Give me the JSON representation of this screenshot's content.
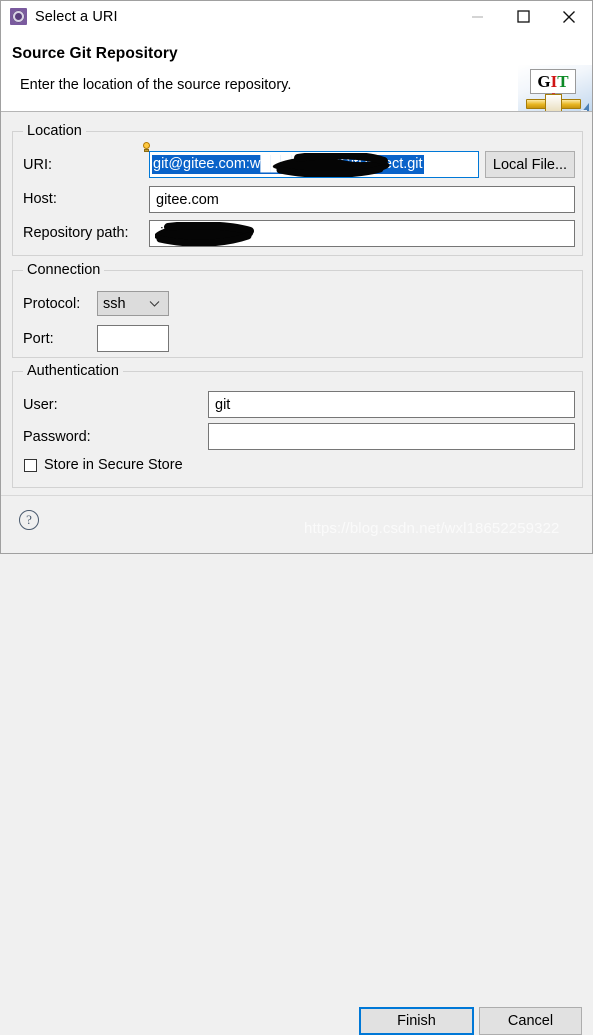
{
  "window": {
    "title": "Select a URI",
    "icon": "uri-dialog-icon",
    "controls": {
      "minimize": "minimize-icon",
      "maximize": "maximize-icon",
      "close": "close-icon"
    }
  },
  "header": {
    "title": "Source Git Repository",
    "subtitle": "Enter the location of the source repository.",
    "logo": {
      "g": "G",
      "i": "I",
      "t": "T"
    }
  },
  "location": {
    "group_label": "Location",
    "uri_label": "URI:",
    "uri_value": "git@gitee.com:w███████i/GitProject.git",
    "uri_selected": true,
    "local_file_button": "Local File...",
    "host_label": "Host:",
    "host_value": "gitee.com",
    "repo_path_label": "Repository path:",
    "repo_path_value": "███████i/GitProject.git"
  },
  "connection": {
    "group_label": "Connection",
    "protocol_label": "Protocol:",
    "protocol_value": "ssh",
    "protocol_options": [
      "ssh"
    ],
    "port_label": "Port:",
    "port_value": "",
    "port_placeholder": ""
  },
  "authentication": {
    "group_label": "Authentication",
    "user_label": "User:",
    "user_value": "git",
    "password_label": "Password:",
    "password_value": "",
    "store_label": "Store in Secure Store",
    "store_checked": false
  },
  "footer": {
    "help": "?",
    "finish_button": "Finish",
    "cancel_button": "Cancel"
  },
  "watermark": {
    "text": "https://blog.csdn.net/wxl18652259322"
  },
  "colors": {
    "accent": "#0078d7",
    "selection": "#0a63c9",
    "window_bg": "#f0f0f0",
    "field_bg": "#ffffff"
  }
}
